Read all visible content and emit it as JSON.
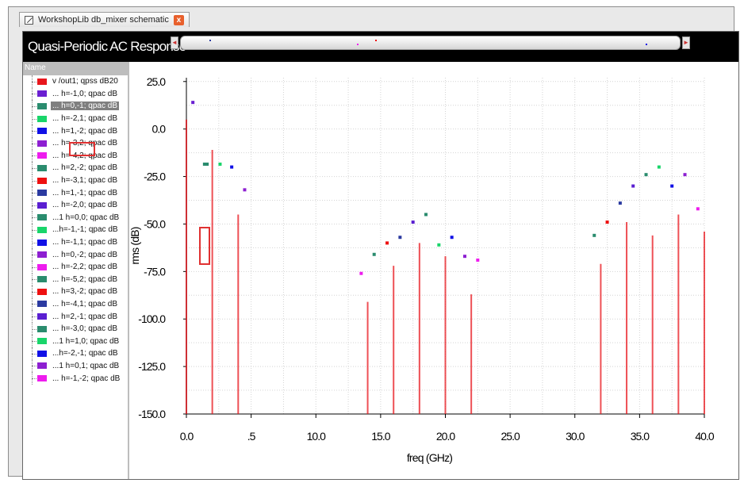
{
  "window": {
    "tab_title": "WorkshopLib db_mixer schematic",
    "close_glyph": "x",
    "plot_title": "Quasi-Periodic AC Response"
  },
  "legend": {
    "header": "Name",
    "selected_index": 2,
    "items": [
      {
        "label": "v /out1; qpss dB20",
        "color": "#e8161c"
      },
      {
        "label": "... h=-1,0; qpac dB",
        "color": "#6a1fd1"
      },
      {
        "label": "... h=0,-1; qpac dB",
        "color": "#2a8c6e"
      },
      {
        "label": "... h=-2,1; qpac dB",
        "color": "#19d56a"
      },
      {
        "label": "... h=1,-2; qpac dB",
        "color": "#1010e6"
      },
      {
        "label": "... h=-3,2; qpac dB",
        "color": "#8d1fd1"
      },
      {
        "label": "... h=-4,2; qpac dB",
        "color": "#ee1cee"
      },
      {
        "label": "... h=2,-2; qpac dB",
        "color": "#2a8c6e"
      },
      {
        "label": "... h=-3,1; qpac dB",
        "color": "#ee1010"
      },
      {
        "label": "... h=1,-1; qpac dB",
        "color": "#2b3aa0"
      },
      {
        "label": "... h=-2,0; qpac dB",
        "color": "#5a1fd1"
      },
      {
        "label": "...1 h=0,0; qpac dB",
        "color": "#2a8c6e"
      },
      {
        "label": "...h=-1,-1; qpac dB",
        "color": "#19d56a"
      },
      {
        "label": "... h=-1,1; qpac dB",
        "color": "#1010e6"
      },
      {
        "label": "... h=0,-2; qpac dB",
        "color": "#8d1fd1"
      },
      {
        "label": "... h=-2,2; qpac dB",
        "color": "#ee1cee"
      },
      {
        "label": "... h=-5,2; qpac dB",
        "color": "#2a8c6e"
      },
      {
        "label": "... h=3,-2; qpac dB",
        "color": "#ee1010"
      },
      {
        "label": "... h=-4,1; qpac dB",
        "color": "#2b3aa0"
      },
      {
        "label": "... h=2,-1; qpac dB",
        "color": "#5a1fd1"
      },
      {
        "label": "... h=-3,0; qpac dB",
        "color": "#2a8c6e"
      },
      {
        "label": "...1 h=1,0; qpac dB",
        "color": "#19d56a"
      },
      {
        "label": "...h=-2,-1; qpac dB",
        "color": "#1010e6"
      },
      {
        "label": "...1 h=0,1; qpac dB",
        "color": "#8d1fd1"
      },
      {
        "label": "... h=-1,-2; qpac dB",
        "color": "#ee1cee"
      }
    ]
  },
  "chart_data": {
    "type": "scatter",
    "title": "",
    "xlabel": "freq (GHz)",
    "ylabel": "rms (dB)",
    "xlim": [
      0,
      40
    ],
    "ylim": [
      -150,
      27
    ],
    "grid": true,
    "x_ticks": [
      {
        "v": 0,
        "label": "0.0"
      },
      {
        "v": 5,
        "label": ".5"
      },
      {
        "v": 10,
        "label": "10.0"
      },
      {
        "v": 15,
        "label": "15.0"
      },
      {
        "v": 20,
        "label": "20.0"
      },
      {
        "v": 25,
        "label": "25.0"
      },
      {
        "v": 30,
        "label": "30.0"
      },
      {
        "v": 35,
        "label": "35.0"
      },
      {
        "v": 40,
        "label": "40.0"
      }
    ],
    "y_ticks": [
      {
        "v": 25,
        "label": "25.0"
      },
      {
        "v": 0,
        "label": "0.0"
      },
      {
        "v": -25,
        "label": "-25.0"
      },
      {
        "v": -50,
        "label": "-50.0"
      },
      {
        "v": -75,
        "label": "-75.0"
      },
      {
        "v": -100,
        "label": "-100.0"
      },
      {
        "v": -125,
        "label": "-125.0"
      },
      {
        "v": -150,
        "label": "-150.0"
      }
    ],
    "stem_series": {
      "name": "v /out1; qpss dB20",
      "color": "#e8161c",
      "points": [
        {
          "x": 0,
          "y": 5
        },
        {
          "x": 2,
          "y": -11
        },
        {
          "x": 4,
          "y": -45
        },
        {
          "x": 14,
          "y": -91
        },
        {
          "x": 16,
          "y": -72
        },
        {
          "x": 18,
          "y": -60
        },
        {
          "x": 20,
          "y": -67
        },
        {
          "x": 22,
          "y": -87
        },
        {
          "x": 32,
          "y": -71
        },
        {
          "x": 34,
          "y": -49
        },
        {
          "x": 36,
          "y": -56
        },
        {
          "x": 38,
          "y": -45
        },
        {
          "x": 40,
          "y": -54
        }
      ]
    },
    "points": [
      {
        "x": 0.5,
        "y": 14,
        "color": "#6a1fd1"
      },
      {
        "x": 1.4,
        "y": -18.5,
        "color": "#2a8c6e"
      },
      {
        "x": 1.6,
        "y": -18.5,
        "color": "#2a8c6e"
      },
      {
        "x": 2.6,
        "y": -18.5,
        "color": "#19d56a"
      },
      {
        "x": 3.5,
        "y": -20,
        "color": "#1010e6"
      },
      {
        "x": 4.5,
        "y": -32,
        "color": "#8d1fd1"
      },
      {
        "x": 13.5,
        "y": -76,
        "color": "#ee1cee"
      },
      {
        "x": 14.5,
        "y": -66,
        "color": "#2a8c6e"
      },
      {
        "x": 15.5,
        "y": -60,
        "color": "#ee1010"
      },
      {
        "x": 16.5,
        "y": -57,
        "color": "#2b3aa0"
      },
      {
        "x": 17.5,
        "y": -49,
        "color": "#5a1fd1"
      },
      {
        "x": 18.5,
        "y": -45,
        "color": "#2a8c6e"
      },
      {
        "x": 19.5,
        "y": -61,
        "color": "#19d56a"
      },
      {
        "x": 20.5,
        "y": -57,
        "color": "#1010e6"
      },
      {
        "x": 21.5,
        "y": -67,
        "color": "#8d1fd1"
      },
      {
        "x": 22.5,
        "y": -69,
        "color": "#ee1cee"
      },
      {
        "x": 31.5,
        "y": -56,
        "color": "#2a8c6e"
      },
      {
        "x": 32.5,
        "y": -49,
        "color": "#ee1010"
      },
      {
        "x": 33.5,
        "y": -39,
        "color": "#2b3aa0"
      },
      {
        "x": 34.5,
        "y": -30,
        "color": "#5a1fd1"
      },
      {
        "x": 35.5,
        "y": -24,
        "color": "#2a8c6e"
      },
      {
        "x": 36.5,
        "y": -20,
        "color": "#19d56a"
      },
      {
        "x": 37.5,
        "y": -30,
        "color": "#1010e6"
      },
      {
        "x": 38.5,
        "y": -24,
        "color": "#8d1fd1"
      },
      {
        "x": 39.5,
        "y": -42,
        "color": "#ee1cee"
      }
    ],
    "overview_marks": [
      {
        "x": 2.0,
        "color": "#2b3aa0"
      },
      {
        "x": 14.0,
        "color": "#ee1cee"
      },
      {
        "x": 15.5,
        "color": "#ee1010"
      },
      {
        "x": 37.5,
        "color": "#1010e6"
      }
    ]
  }
}
